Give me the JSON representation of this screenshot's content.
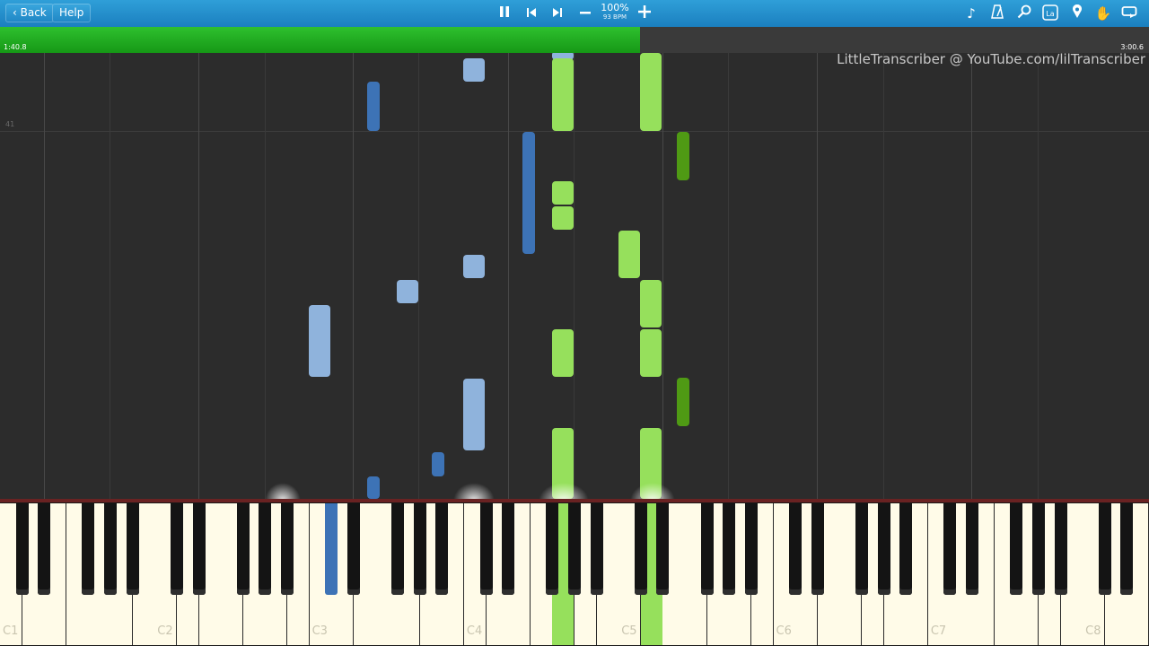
{
  "toolbar": {
    "back_label": "Back",
    "help_label": "Help",
    "speed_percent": "100%",
    "tempo": "93 BPM",
    "icons": [
      "pause-icon",
      "previous-icon",
      "next-icon",
      "minus-icon",
      "plus-icon",
      "note-icon",
      "metronome-icon",
      "zoom-icon",
      "keyboard-labels-icon",
      "marker-icon",
      "hand-icon",
      "loop-icon"
    ]
  },
  "progress": {
    "time_left": "1:40.8",
    "time_right": "3:00.6",
    "fraction": 0.557,
    "color": "#1fae1f"
  },
  "watermark": "LittleTranscriber @ YouTube.com/lilTranscriber",
  "measure_number": "41",
  "keyboard": {
    "octave_labels": [
      "C1",
      "C2",
      "C3",
      "C4",
      "C5",
      "C6",
      "C7",
      "C8"
    ]
  },
  "colors": {
    "left_hand_dark": "#3d73b6",
    "left_hand_light": "#8fb3dc",
    "right_hand_light": "#96e05c",
    "right_hand_dark": "#4f9a14"
  }
}
